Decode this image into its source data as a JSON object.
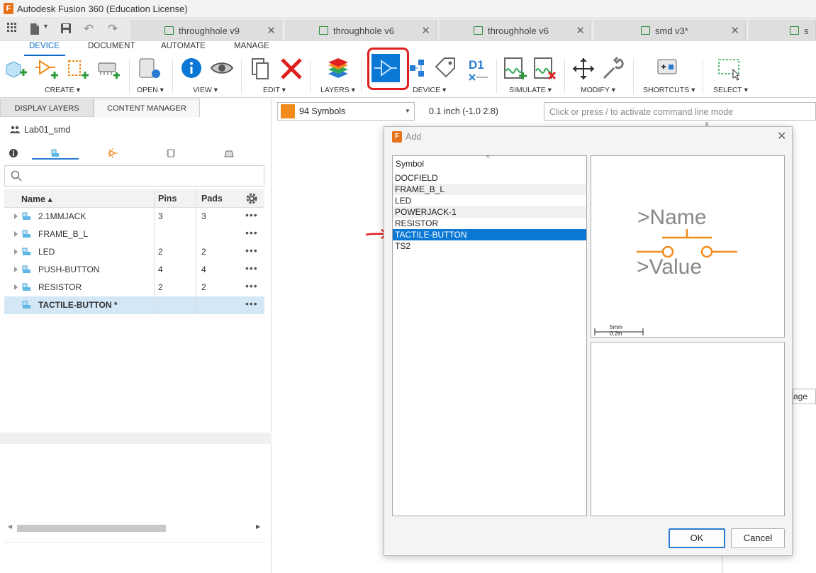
{
  "titlebar": {
    "title": "Autodesk Fusion 360 (Education License)"
  },
  "tabs": [
    {
      "label": "throughhole v9"
    },
    {
      "label": "throughhole v6"
    },
    {
      "label": "throughhole v6"
    },
    {
      "label": "smd v3*"
    },
    {
      "label": "s"
    }
  ],
  "ribbon": {
    "tabs": [
      "DEVICE",
      "DOCUMENT",
      "AUTOMATE",
      "MANAGE"
    ],
    "groups": [
      "CREATE",
      "OPEN",
      "VIEW",
      "EDIT",
      "LAYERS",
      "DEVICE",
      "SIMULATE",
      "MODIFY",
      "SHORTCUTS",
      "SELECT"
    ],
    "device_name_label": "D1"
  },
  "panel": {
    "tabs": [
      "DISPLAY LAYERS",
      "CONTENT MANAGER"
    ],
    "project": "Lab01_smd",
    "columns": {
      "name": "Name",
      "pins": "Pins",
      "pads": "Pads"
    },
    "rows": [
      {
        "name": "2.1MMJACK",
        "pins": "3",
        "pads": "3"
      },
      {
        "name": "FRAME_B_L",
        "pins": "",
        "pads": ""
      },
      {
        "name": "LED",
        "pins": "2",
        "pads": "2"
      },
      {
        "name": "PUSH-BUTTON",
        "pins": "4",
        "pads": "4"
      },
      {
        "name": "RESISTOR",
        "pins": "2",
        "pads": "2"
      },
      {
        "name": "TACTILE-BUTTON *",
        "pins": "",
        "pads": ""
      }
    ]
  },
  "toolbar2": {
    "layer": "94 Symbols",
    "layer_color": "#f28a1c",
    "coord": "0.1 inch (-1.0 2.8)",
    "cmd_placeholder": "Click or press / to activate command line mode"
  },
  "dialog": {
    "title": "Add",
    "list_header": "Symbol",
    "symbols": [
      "DOCFIELD",
      "FRAME_B_L",
      "LED",
      "POWERJACK-1",
      "RESISTOR",
      "TACTILE-BUTTON",
      "TS2"
    ],
    "selected": "TACTILE-BUTTON",
    "preview": {
      "name_label": ">Name",
      "value_label": ">Value",
      "scale_mm": "5mm",
      "scale_in": "0.2in"
    },
    "ok": "OK",
    "cancel": "Cancel"
  },
  "canvas_fragment": "age",
  "colors": {
    "accent": "#0a78d4",
    "symbol": "#f28a1c",
    "annotation": "#e02020"
  }
}
